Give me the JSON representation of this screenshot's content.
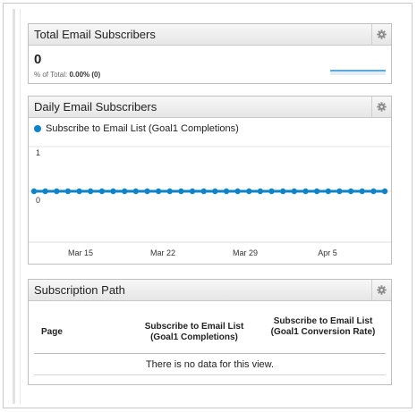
{
  "panels": {
    "total": {
      "title": "Total Email Subscribers",
      "value": "0",
      "pct_label": "% of Total:",
      "pct_value": "0.00% (0)"
    },
    "daily": {
      "title": "Daily Email Subscribers",
      "legend": "Subscribe to Email List (Goal1 Completions)"
    },
    "path": {
      "title": "Subscription Path",
      "columns": [
        "Page",
        "Subscribe to Email List (Goal1 Completions)",
        "Subscribe to Email List (Goal1 Conversion Rate)"
      ],
      "empty_message": "There is no data for this view."
    }
  },
  "icons": {
    "settings": "gear-icon"
  },
  "colors": {
    "series": "#0e83c8",
    "sparkline": "#2a8fd0"
  },
  "chart_data": {
    "type": "line",
    "ylim": [
      0,
      1
    ],
    "y_ticks": [
      "1",
      "0"
    ],
    "x_ticks": [
      "Mar 15",
      "Mar 22",
      "Mar 29",
      "Apr 5"
    ],
    "series": [
      {
        "name": "Subscribe to Email List (Goal1 Completions)",
        "values": [
          0,
          0,
          0,
          0,
          0,
          0,
          0,
          0,
          0,
          0,
          0,
          0,
          0,
          0,
          0,
          0,
          0,
          0,
          0,
          0,
          0,
          0,
          0,
          0,
          0,
          0,
          0,
          0,
          0,
          0,
          0,
          0
        ]
      }
    ]
  }
}
